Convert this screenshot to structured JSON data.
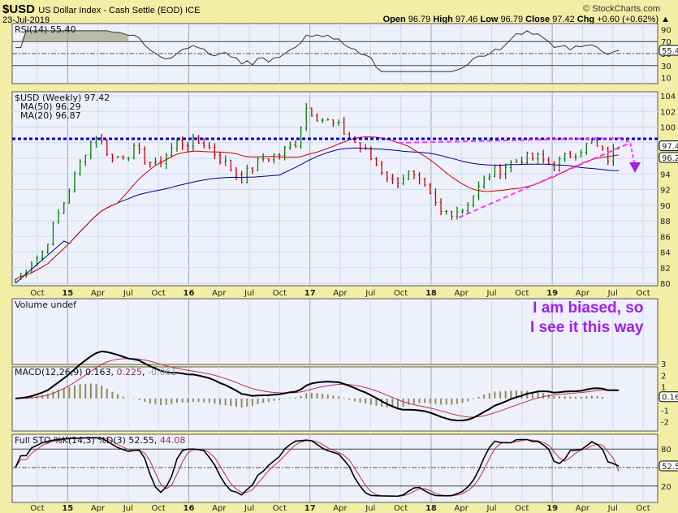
{
  "header": {
    "symbol": "$USD",
    "name": "US Dollar Index - Cash Settle (EOD) ICE",
    "date": "23-Jul-2019",
    "brand": "© StockCharts.com",
    "open_label": "Open",
    "open": "96.79",
    "high_label": "High",
    "high": "97.46",
    "low_label": "Low",
    "low": "96.79",
    "close_label": "Close",
    "close": "97.42",
    "chg_label": "Chg",
    "chg": "+0.60 (+0.62%)"
  },
  "annotation": {
    "line1": "I am biased, so",
    "line2": "I see it this way",
    "color": "#a020f0"
  },
  "chart_data": [
    {
      "type": "line",
      "title": "RSI(14) 55.40",
      "ylim": [
        0,
        100
      ],
      "yticks": [
        "90",
        "70",
        "50",
        "30",
        "10"
      ],
      "last": "55.40"
    },
    {
      "type": "bar",
      "title": "$USD (Weekly) 97.42",
      "ylim": [
        80,
        104
      ],
      "yticks": [
        "104",
        "102",
        "100",
        "98",
        "96",
        "94",
        "92",
        "90",
        "88",
        "86",
        "84",
        "82",
        "80"
      ],
      "ma50": "MA(50) 96.29",
      "ma20": "MA(20) 96.87",
      "last": "97.42",
      "last_ma": "96.29",
      "xticks": [
        "Oct",
        "15",
        "Apr",
        "Jul",
        "Oct",
        "16",
        "Apr",
        "Jul",
        "Oct",
        "17",
        "Apr",
        "Jul",
        "Oct",
        "18",
        "Apr",
        "Jul",
        "Oct",
        "19",
        "Apr",
        "Jul",
        "Oct"
      ],
      "close_keypoints": [
        [
          0,
          80.5
        ],
        [
          5,
          84
        ],
        [
          10,
          92
        ],
        [
          13,
          97
        ],
        [
          15,
          99
        ],
        [
          18,
          96
        ],
        [
          22,
          97
        ],
        [
          26,
          95
        ],
        [
          30,
          98
        ],
        [
          35,
          98
        ],
        [
          38,
          96
        ],
        [
          42,
          93.5
        ],
        [
          46,
          96
        ],
        [
          49,
          96.5
        ],
        [
          52,
          98
        ],
        [
          54,
          102.5
        ],
        [
          57,
          101
        ],
        [
          60,
          100
        ],
        [
          63,
          98
        ],
        [
          66,
          96
        ],
        [
          70,
          93
        ],
        [
          73,
          94
        ],
        [
          76,
          92
        ],
        [
          79,
          89
        ],
        [
          83,
          89.5
        ],
        [
          88,
          94
        ],
        [
          94,
          96
        ],
        [
          97,
          96
        ],
        [
          100,
          95
        ],
        [
          103,
          96.5
        ],
        [
          107,
          98
        ],
        [
          110,
          96
        ],
        [
          112,
          97.42
        ]
      ],
      "resistance": 98.5,
      "colors": {
        "up": "#008000",
        "down": "#d00000",
        "ma50": "#00008b",
        "ma20": "#cc0000",
        "trend": "#ff33ff",
        "resistance": "#0000cc"
      }
    },
    {
      "type": "bar",
      "title": "Volume undef"
    },
    {
      "type": "line",
      "title": "MACD(12,26,9)",
      "macd": "0.163",
      "signal": "0.225",
      "hist": "-0.061",
      "yticks": [
        "3",
        "2",
        "1",
        "-1",
        "-2"
      ],
      "last": "0.163"
    },
    {
      "type": "line",
      "title": "Full STO %K(14,3) %D(3)",
      "k": "52.55",
      "d": "44.08",
      "yticks": [
        "80",
        "20"
      ],
      "last": "52.55"
    }
  ]
}
